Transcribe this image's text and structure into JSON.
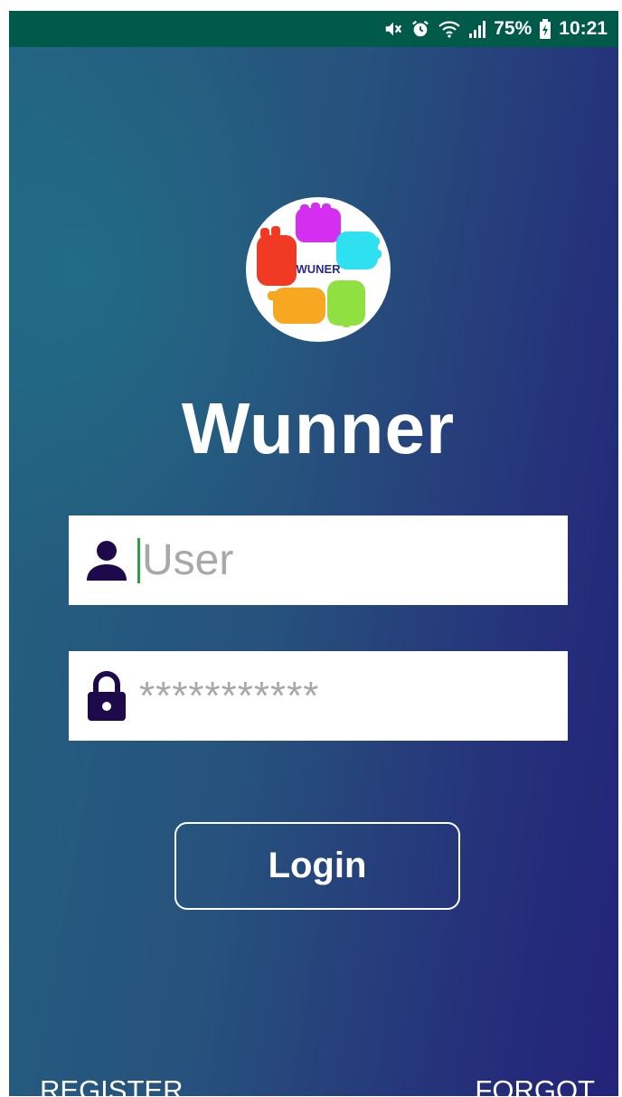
{
  "status_bar": {
    "battery": "75%",
    "time": "10:21",
    "icons": [
      "mute-icon",
      "alarm-icon",
      "wifi-icon",
      "signal-icon",
      "battery-icon"
    ]
  },
  "logo": {
    "text": "WUNER"
  },
  "app": {
    "title": "Wunner"
  },
  "form": {
    "user_placeholder": "User",
    "password_value": "***********",
    "login_label": "Login"
  },
  "links": {
    "register": "REGISTER",
    "forgot": "FORGOT"
  },
  "colors": {
    "status_bar": "#005a4a",
    "icon": "#1e0a4a",
    "cursor": "#2e9e3e"
  }
}
